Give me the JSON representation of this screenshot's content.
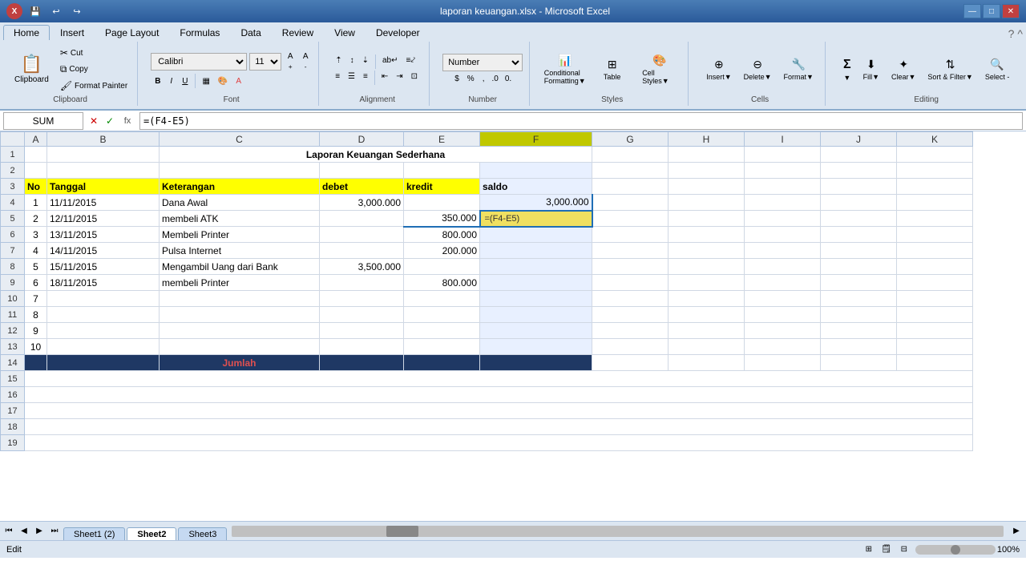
{
  "titleBar": {
    "title": "laporan keuangan.xlsx - Microsoft Excel",
    "buttons": [
      "—",
      "□",
      "✕"
    ]
  },
  "menuBar": {
    "items": [
      "Home",
      "Insert",
      "Page Layout",
      "Formulas",
      "Data",
      "Review",
      "View",
      "Developer"
    ]
  },
  "formulaBar": {
    "nameBox": "SUM",
    "formula": "=(F4-E5)"
  },
  "spreadsheet": {
    "title": "Laporan Keuangan Sederhana",
    "headers": [
      "No",
      "Tanggal",
      "Keterangan",
      "debet",
      "kredit",
      "saldo"
    ],
    "colLetters": [
      "",
      "A",
      "B",
      "C",
      "D",
      "E",
      "F",
      "G",
      "H",
      "I",
      "J",
      "K"
    ],
    "rows": [
      {
        "no": "1",
        "tanggal": "11/11/2015",
        "keterangan": "Dana Awal",
        "debet": "3,000.000",
        "kredit": "",
        "saldo": "3,000.000"
      },
      {
        "no": "2",
        "tanggal": "12/11/2015",
        "keterangan": "membeli ATK",
        "debet": "",
        "kredit": "350.000",
        "saldo": "=(F4-E5)"
      },
      {
        "no": "3",
        "tanggal": "13/11/2015",
        "keterangan": "Membeli Printer",
        "debet": "",
        "kredit": "800.000",
        "saldo": ""
      },
      {
        "no": "4",
        "tanggal": "14/11/2015",
        "keterangan": "Pulsa Internet",
        "debet": "",
        "kredit": "200.000",
        "saldo": ""
      },
      {
        "no": "5",
        "tanggal": "15/11/2015",
        "keterangan": "Mengambil Uang dari Bank",
        "debet": "3,500.000",
        "kredit": "",
        "saldo": ""
      },
      {
        "no": "6",
        "tanggal": "18/11/2015",
        "keterangan": "membeli Printer",
        "debet": "",
        "kredit": "800.000",
        "saldo": ""
      },
      {
        "no": "7",
        "tanggal": "",
        "keterangan": "",
        "debet": "",
        "kredit": "",
        "saldo": ""
      },
      {
        "no": "8",
        "tanggal": "",
        "keterangan": "",
        "debet": "",
        "kredit": "",
        "saldo": ""
      },
      {
        "no": "9",
        "tanggal": "",
        "keterangan": "",
        "debet": "",
        "kredit": "",
        "saldo": ""
      },
      {
        "no": "10",
        "tanggal": "",
        "keterangan": "",
        "debet": "",
        "kredit": "",
        "saldo": ""
      }
    ],
    "totalLabel": "Jumlah"
  },
  "sheets": [
    "Sheet1 (2)",
    "Sheet2",
    "Sheet3"
  ],
  "activeSheet": "Sheet2",
  "statusBar": {
    "mode": "Edit",
    "zoom": "100%"
  },
  "ribbon": {
    "clipboard": "Clipboard",
    "font": "Font",
    "alignment": "Alignment",
    "number": "Number",
    "styles": "Styles",
    "cells": "Cells",
    "editing": "Editing",
    "fontName": "Calibri",
    "fontSize": "11",
    "numberFormat": "Number",
    "tableLabel": "Table",
    "selectLabel": "Select -"
  }
}
